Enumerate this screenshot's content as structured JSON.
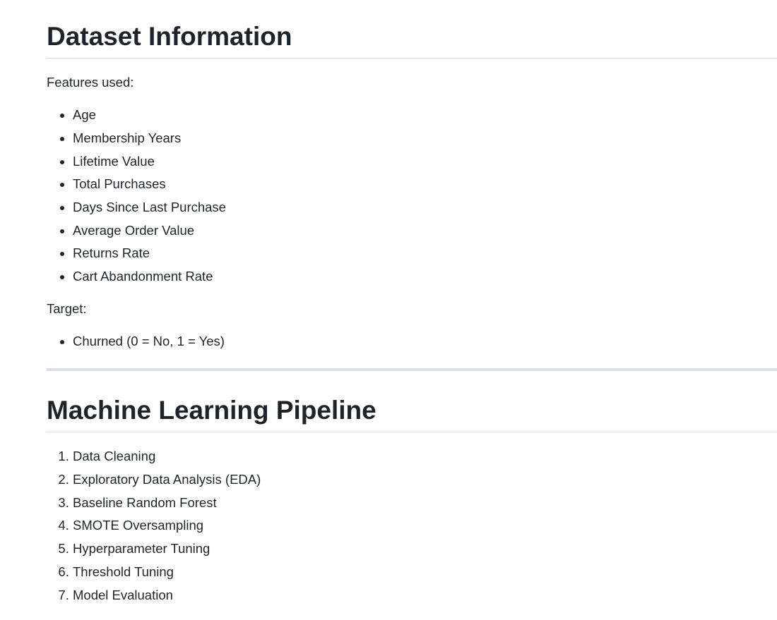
{
  "sections": {
    "dataset": {
      "heading": "Dataset Information",
      "features_label": "Features used:",
      "features": [
        "Age",
        "Membership Years",
        "Lifetime Value",
        "Total Purchases",
        "Days Since Last Purchase",
        "Average Order Value",
        "Returns Rate",
        "Cart Abandonment Rate"
      ],
      "target_label": "Target:",
      "targets": [
        "Churned (0 = No, 1 = Yes)"
      ]
    },
    "pipeline": {
      "heading": "Machine Learning Pipeline",
      "steps": [
        "Data Cleaning",
        "Exploratory Data Analysis (EDA)",
        "Baseline Random Forest",
        "SMOTE Oversampling",
        "Hyperparameter Tuning",
        "Threshold Tuning",
        "Model Evaluation"
      ]
    }
  },
  "colors": {
    "text": "#1f2328",
    "rule": "#d8dee4",
    "background": "#ffffff"
  }
}
